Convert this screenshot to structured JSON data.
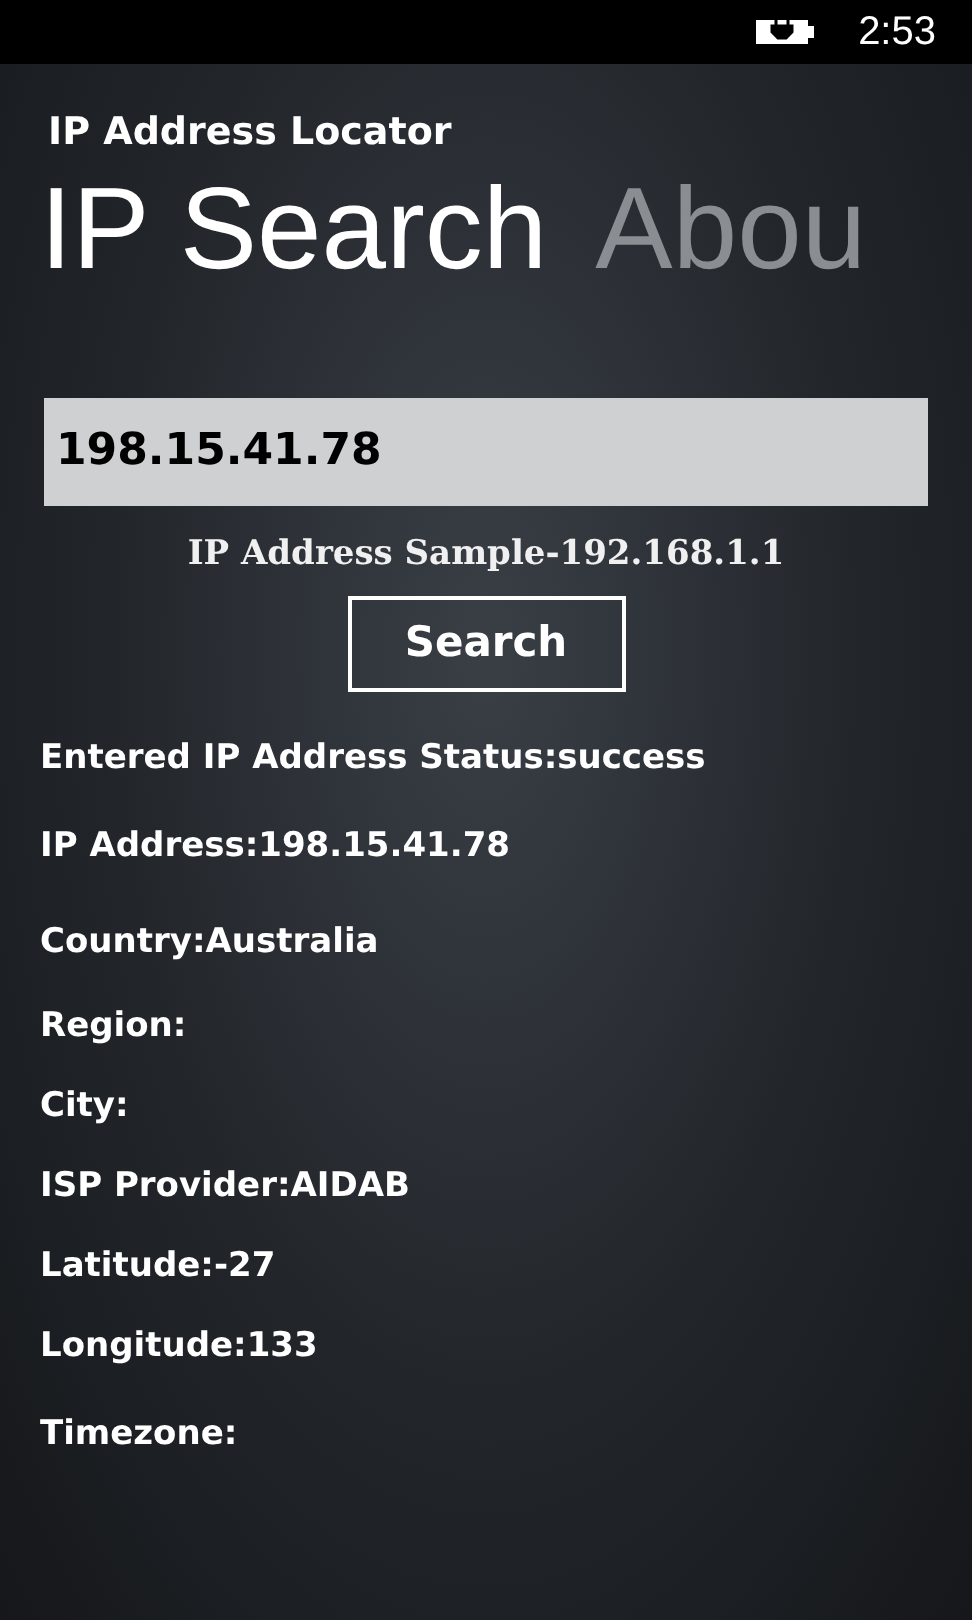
{
  "status_bar": {
    "time": "2:53",
    "battery_charging": true
  },
  "app_title": "IP Address Locator",
  "pivot": [
    {
      "label": "IP Search",
      "selected": true
    },
    {
      "label": "Abou",
      "selected": false
    }
  ],
  "ip_field": {
    "value": "198.15.41.78"
  },
  "hint": "IP Address Sample-192.168.1.1",
  "search_button": "Search",
  "results": [
    "Entered IP Address Status:success",
    "IP Address:198.15.41.78",
    "Country:Australia",
    "Region:",
    "City:",
    "ISP Provider:AIDAB",
    "Latitude:-27",
    "Longitude:133",
    "Timezone:"
  ]
}
